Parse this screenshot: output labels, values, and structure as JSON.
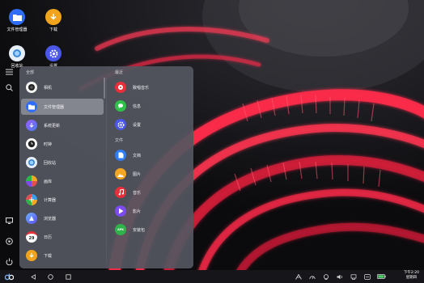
{
  "desktop": {
    "icons": [
      {
        "label": "文件管理器",
        "icon": "folder-icon",
        "color": "#2f6df6"
      },
      {
        "label": "下载",
        "icon": "download-icon",
        "color": "#f0a31c"
      },
      {
        "label": "回收站",
        "icon": "trash-icon",
        "color": "#3a8ad8"
      },
      {
        "label": "设置",
        "icon": "gear-icon",
        "color": "#4a57e8"
      }
    ]
  },
  "launcher": {
    "all_title": "全部",
    "recent_title": "最近",
    "files_title": "文件",
    "all_apps": [
      {
        "label": "相机",
        "icon": "camera-icon",
        "color": "#2b2b2e"
      },
      {
        "label": "文件管理器",
        "icon": "folder-icon",
        "color": "#2f6df6",
        "selected": true
      },
      {
        "label": "系统更新",
        "icon": "system-update-icon",
        "color": "#7d4cf0"
      },
      {
        "label": "时钟",
        "icon": "clock-icon",
        "color": "#ffffff"
      },
      {
        "label": "回收站",
        "icon": "trash-icon",
        "color": "#3a8ad8"
      },
      {
        "label": "画库",
        "icon": "gallery-icon",
        "color": "#e14f4f"
      },
      {
        "label": "计算器",
        "icon": "calculator-icon",
        "color": "#3aa0f0"
      },
      {
        "label": "浏览器",
        "icon": "browser-icon",
        "color": "#5b6cf2"
      },
      {
        "label": "日历",
        "icon": "calendar-icon",
        "color": "#ffffff",
        "text": "29"
      },
      {
        "label": "下载",
        "icon": "download-icon",
        "color": "#f0a31c"
      }
    ],
    "recent_apps": [
      {
        "label": "致唱音乐",
        "icon": "music-player-icon",
        "color": "#e7303a"
      },
      {
        "label": "信息",
        "icon": "message-icon",
        "color": "#2fc24a"
      },
      {
        "label": "设置",
        "icon": "gear-icon",
        "color": "#4a57e8"
      }
    ],
    "file_types": [
      {
        "label": "文档",
        "icon": "document-icon",
        "color": "#2f7df6"
      },
      {
        "label": "图片",
        "icon": "image-icon",
        "color": "#f5a623"
      },
      {
        "label": "音乐",
        "icon": "music-icon",
        "color": "#e7303a"
      },
      {
        "label": "影片",
        "icon": "video-icon",
        "color": "#7d4cf0"
      },
      {
        "label": "安装包",
        "icon": "apk-icon",
        "color": "#2fb24a",
        "text": "APK"
      }
    ]
  },
  "taskbar": {
    "clock_time": "下午2:20",
    "clock_day": "星期四"
  }
}
